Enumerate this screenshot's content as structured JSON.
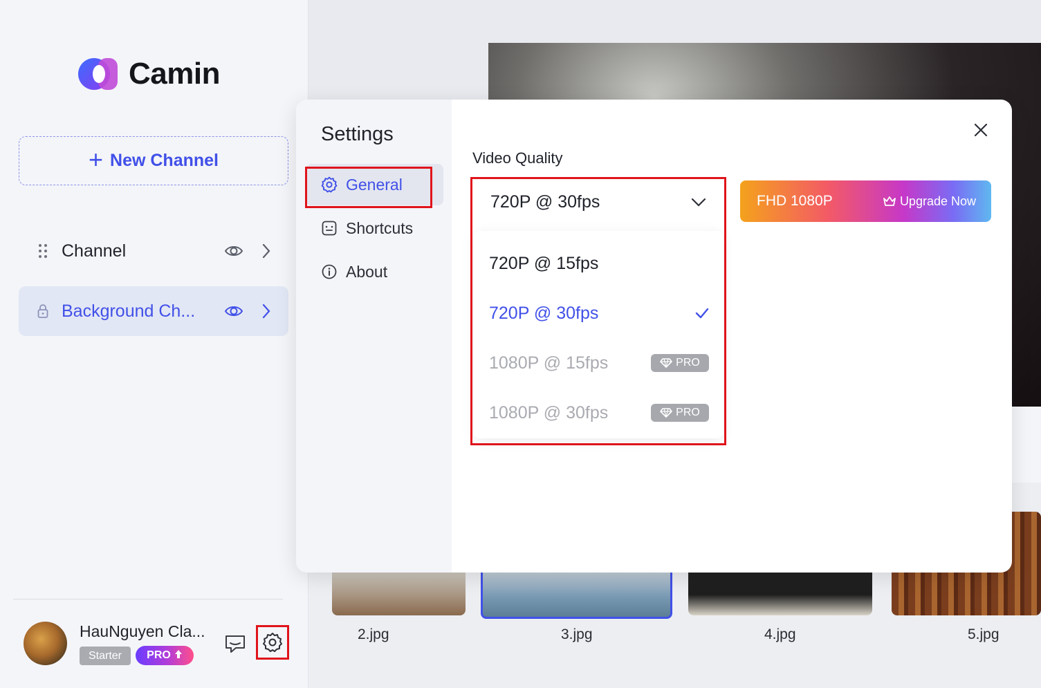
{
  "app": {
    "name": "Camin"
  },
  "sidebar": {
    "new_channel_label": "New Channel",
    "channels": [
      {
        "name": "Channel"
      },
      {
        "name": "Background Ch..."
      }
    ],
    "user": {
      "name": "HauNguyen Cla...",
      "plan": "Starter",
      "pro_label": "PRO"
    }
  },
  "thumbnails": [
    "2.jpg",
    "3.jpg",
    "4.jpg",
    "5.jpg"
  ],
  "settings": {
    "title": "Settings",
    "nav": [
      {
        "label": "General"
      },
      {
        "label": "Shortcuts"
      },
      {
        "label": "About"
      }
    ],
    "video_quality": {
      "label": "Video Quality",
      "selected": "720P @ 30fps",
      "options": [
        {
          "label": "720P @ 15fps"
        },
        {
          "label": "720P @ 30fps"
        },
        {
          "label": "1080P @ 15fps",
          "badge": "PRO"
        },
        {
          "label": "1080P @ 30fps",
          "badge": "PRO"
        }
      ]
    },
    "upgrade": {
      "quality": "FHD 1080P",
      "cta": "Upgrade Now"
    }
  },
  "colors": {
    "accent": "#4150e8",
    "highlight": "#e0141b",
    "disabled": "#a9abb1"
  }
}
